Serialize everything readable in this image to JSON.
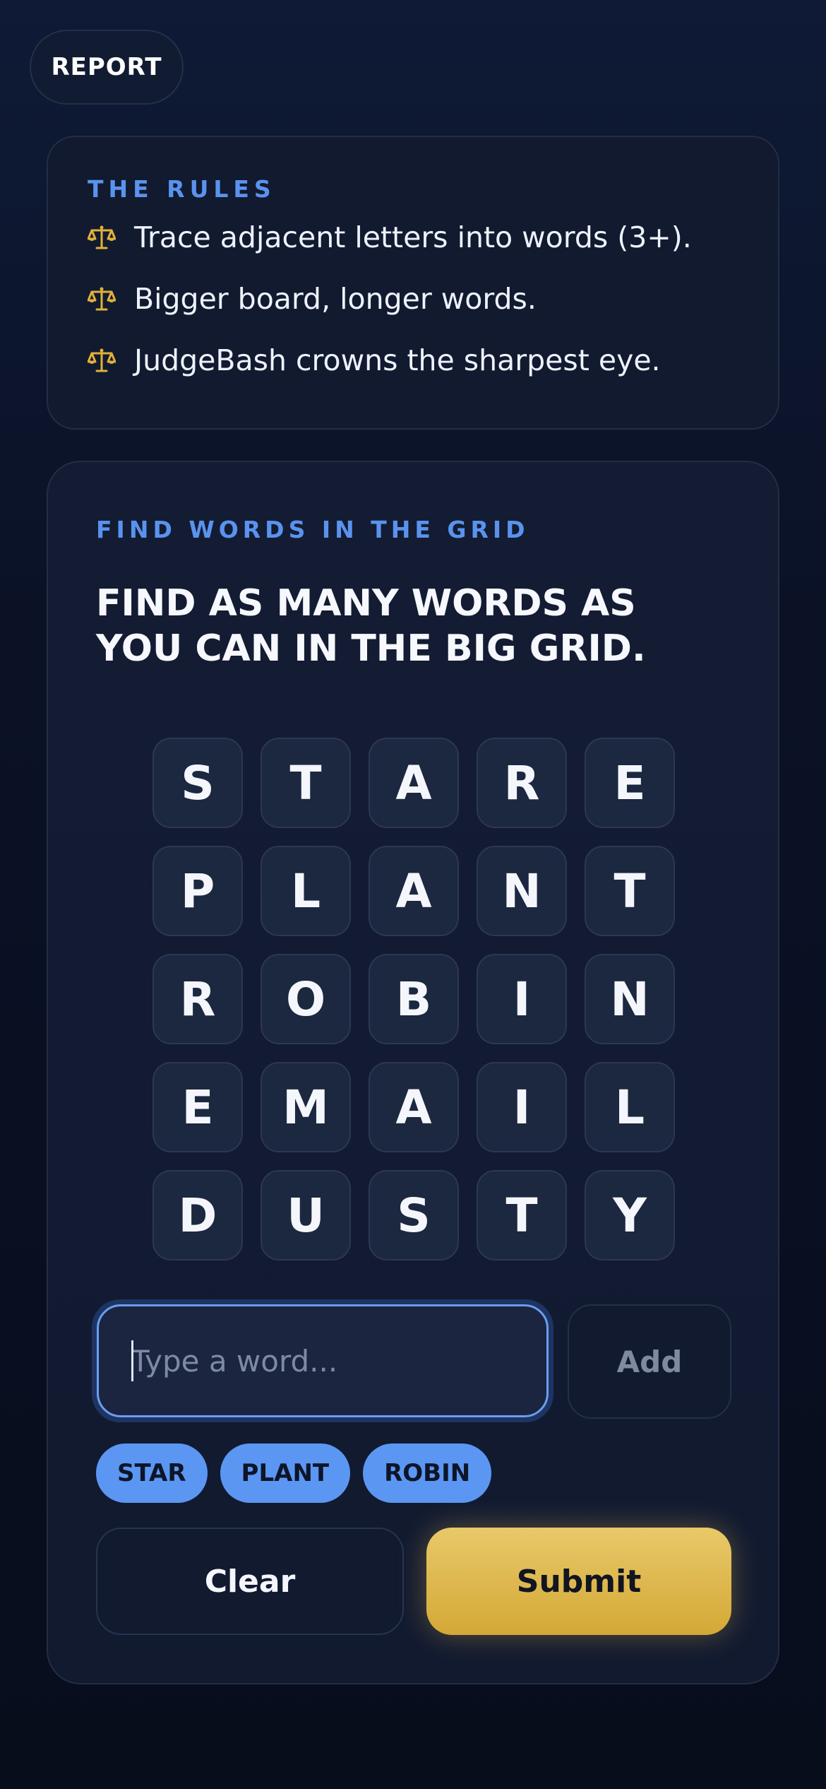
{
  "header": {
    "report_label": "REPORT"
  },
  "rules": {
    "heading": "THE RULES",
    "icon": "scales-icon",
    "icon_color": "#e0b13a",
    "items": [
      "Trace adjacent letters into words (3+).",
      "Bigger board, longer words.",
      "JudgeBash crowns the sharpest eye."
    ]
  },
  "game": {
    "kicker": "FIND WORDS IN THE GRID",
    "title": "FIND AS MANY WORDS AS YOU CAN IN THE BIG GRID.",
    "grid": [
      [
        "S",
        "T",
        "A",
        "R",
        "E"
      ],
      [
        "P",
        "L",
        "A",
        "N",
        "T"
      ],
      [
        "R",
        "O",
        "B",
        "I",
        "N"
      ],
      [
        "E",
        "M",
        "A",
        "I",
        "L"
      ],
      [
        "D",
        "U",
        "S",
        "T",
        "Y"
      ]
    ],
    "input": {
      "value": "",
      "placeholder": "Type a word..."
    },
    "add_label": "Add",
    "found_words": [
      "STAR",
      "PLANT",
      "ROBIN"
    ],
    "clear_label": "Clear",
    "submit_label": "Submit"
  },
  "colors": {
    "accent_blue": "#5a93ee",
    "chip_blue": "#5b97f2",
    "submit_gold": "#e0b940",
    "background": "#0b1226"
  }
}
